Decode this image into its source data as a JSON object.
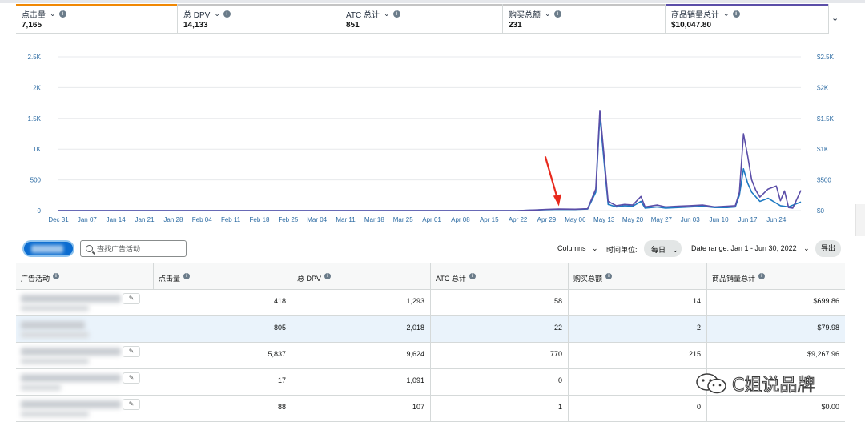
{
  "metrics": [
    {
      "label": "点击量",
      "value": "7,165",
      "color": "#f08804"
    },
    {
      "label": "总 DPV",
      "value": "14,133",
      "color": "#c4c4c4"
    },
    {
      "label": "ATC 总计",
      "value": "851",
      "color": "#c4c4c4"
    },
    {
      "label": "购买总额",
      "value": "231",
      "color": "#c4c4c4"
    },
    {
      "label": "商品销量总计",
      "value": "$10,047.80",
      "color": "#5b4ea8"
    }
  ],
  "chart_data": {
    "type": "line",
    "x_ticks": [
      "Dec 31",
      "Jan 07",
      "Jan 14",
      "Jan 21",
      "Jan 28",
      "Feb 04",
      "Feb 11",
      "Feb 18",
      "Feb 25",
      "Mar 04",
      "Mar 11",
      "Mar 18",
      "Mar 25",
      "Apr 01",
      "Apr 08",
      "Apr 15",
      "Apr 22",
      "Apr 29",
      "May 06",
      "May 13",
      "May 20",
      "May 27",
      "Jun 03",
      "Jun 10",
      "Jun 17",
      "Jun 24"
    ],
    "y_left_ticks": [
      "0",
      "500",
      "1K",
      "1.5K",
      "2K",
      "2.5K"
    ],
    "y_right_ticks": [
      "$0",
      "$500",
      "$1K",
      "$1.5K",
      "$2K",
      "$2.5K"
    ],
    "ylim_left": [
      0,
      2500
    ],
    "ylim_right": [
      0,
      2500
    ],
    "grid": true,
    "series": [
      {
        "color": "#1f7ac2",
        "points": [
          [
            "Dec 31",
            0
          ],
          [
            "Apr 22",
            0
          ],
          [
            "Apr 27",
            10
          ],
          [
            "Apr 29",
            15
          ],
          [
            "May 02",
            20
          ],
          [
            "May 06",
            18
          ],
          [
            "May 09",
            25
          ],
          [
            "May 11",
            300
          ],
          [
            "May 12",
            1550
          ],
          [
            "May 13",
            800
          ],
          [
            "May 14",
            100
          ],
          [
            "May 16",
            60
          ],
          [
            "May 18",
            80
          ],
          [
            "May 20",
            70
          ],
          [
            "May 22",
            150
          ],
          [
            "May 23",
            40
          ],
          [
            "May 26",
            60
          ],
          [
            "May 28",
            40
          ],
          [
            "May 31",
            50
          ],
          [
            "Jun 03",
            60
          ],
          [
            "Jun 06",
            70
          ],
          [
            "Jun 09",
            50
          ],
          [
            "Jun 12",
            50
          ],
          [
            "Jun 14",
            60
          ],
          [
            "Jun 15",
            250
          ],
          [
            "Jun 16",
            680
          ],
          [
            "Jun 17",
            450
          ],
          [
            "Jun 18",
            300
          ],
          [
            "Jun 20",
            150
          ],
          [
            "Jun 22",
            200
          ],
          [
            "Jun 24",
            120
          ],
          [
            "Jun 25",
            80
          ],
          [
            "Jun 27",
            60
          ],
          [
            "Jun 30",
            140
          ]
        ]
      },
      {
        "color": "#5b4ea8",
        "points": [
          [
            "Dec 31",
            0
          ],
          [
            "Apr 22",
            0
          ],
          [
            "Apr 27",
            12
          ],
          [
            "Apr 29",
            20
          ],
          [
            "May 02",
            25
          ],
          [
            "May 06",
            22
          ],
          [
            "May 09",
            30
          ],
          [
            "May 11",
            350
          ],
          [
            "May 12",
            1630
          ],
          [
            "May 13",
            900
          ],
          [
            "May 14",
            150
          ],
          [
            "May 16",
            80
          ],
          [
            "May 18",
            100
          ],
          [
            "May 20",
            90
          ],
          [
            "May 22",
            230
          ],
          [
            "May 23",
            60
          ],
          [
            "May 26",
            90
          ],
          [
            "May 28",
            60
          ],
          [
            "May 31",
            70
          ],
          [
            "Jun 03",
            80
          ],
          [
            "Jun 06",
            90
          ],
          [
            "Jun 09",
            60
          ],
          [
            "Jun 12",
            70
          ],
          [
            "Jun 14",
            80
          ],
          [
            "Jun 15",
            300
          ],
          [
            "Jun 16",
            1250
          ],
          [
            "Jun 17",
            900
          ],
          [
            "Jun 18",
            500
          ],
          [
            "Jun 19",
            330
          ],
          [
            "Jun 20",
            220
          ],
          [
            "Jun 22",
            350
          ],
          [
            "Jun 24",
            400
          ],
          [
            "Jun 25",
            160
          ],
          [
            "Jun 26",
            320
          ],
          [
            "Jun 27",
            50
          ],
          [
            "Jun 28",
            40
          ],
          [
            "Jun 30",
            330
          ]
        ]
      }
    ],
    "annotations": [
      {
        "type": "arrow",
        "color": "#e8291c",
        "target": "May 02"
      }
    ]
  },
  "toolbar": {
    "search_placeholder": "查找广告活动",
    "columns_label": "Columns",
    "unit_label": "时间单位:",
    "unit_value": "每日",
    "date_range": "Date range: Jan 1 - Jun 30, 2022",
    "export_label": "导出"
  },
  "table": {
    "headers": [
      "广告活动",
      "点击量",
      "总 DPV",
      "ATC 总计",
      "购买总额",
      "商品销量总计"
    ],
    "rows": [
      {
        "clicks": "418",
        "dpv": "1,293",
        "atc": "58",
        "purchases": "14",
        "sales": "$699.86"
      },
      {
        "clicks": "805",
        "dpv": "2,018",
        "atc": "22",
        "purchases": "2",
        "sales": "$79.98"
      },
      {
        "clicks": "5,837",
        "dpv": "9,624",
        "atc": "770",
        "purchases": "215",
        "sales": "$9,267.96"
      },
      {
        "clicks": "17",
        "dpv": "1,091",
        "atc": "0",
        "purchases": "",
        "sales": ""
      },
      {
        "clicks": "88",
        "dpv": "107",
        "atc": "1",
        "purchases": "0",
        "sales": "$0.00"
      }
    ]
  },
  "watermark": "C姐说品牌"
}
